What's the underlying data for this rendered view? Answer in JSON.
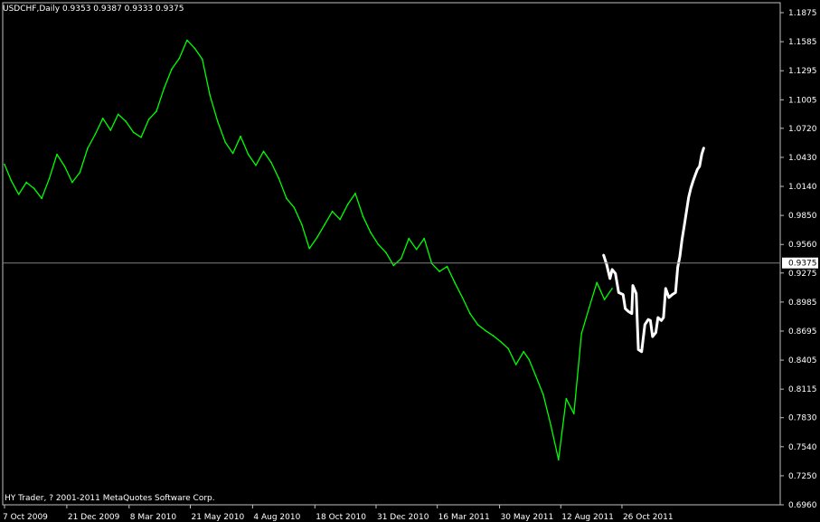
{
  "header": {
    "symbol_line": "USDCHF,Daily  0.9353 0.9387 0.9333 0.9375"
  },
  "footer": {
    "copyright": "HY Trader, ? 2001-2011 MetaQuotes Software Corp."
  },
  "colors": {
    "background": "#000000",
    "frame": "#c0c0c0",
    "history_line": "#00ff00",
    "forecast_line": "#ffffff",
    "current_price_line": "#808080"
  },
  "chart_data": {
    "type": "line",
    "title": "USDCHF,Daily",
    "ohlc_last": {
      "open": 0.9353,
      "high": 0.9387,
      "low": 0.9333,
      "close": 0.9375
    },
    "current_price_label": "0.9375",
    "current_price": 0.9375,
    "ylim": [
      0.6969,
      1.1875
    ],
    "y_ticks": [
      "1.1875",
      "1.1585",
      "1.1295",
      "1.1005",
      "1.0720",
      "1.0430",
      "1.0140",
      "0.9850",
      "0.9560",
      "0.9275",
      "0.8985",
      "0.8695",
      "0.8405",
      "0.8115",
      "0.7830",
      "0.7540",
      "0.7250",
      "0.6960"
    ],
    "x_ticks": [
      "7 Oct 2009",
      "21 Dec 2009",
      "8 Mar 2010",
      "21 May 2010",
      "4 Aug 2010",
      "18 Oct 2010",
      "31 Dec 2010",
      "16 Mar 2011",
      "30 May 2011",
      "12 Aug 2011",
      "26 Oct 2011"
    ],
    "x_index_range": [
      0,
      570
    ],
    "x_tick_indices": [
      0,
      57,
      114,
      170,
      227,
      284,
      340,
      396,
      453,
      509,
      565
    ],
    "series": [
      {
        "color": "#00ff00",
        "x": [
          0,
          6,
          13,
          20,
          27,
          34,
          41,
          48,
          55,
          62,
          69,
          76,
          83,
          90,
          97,
          104,
          111,
          118,
          125,
          132,
          139,
          146,
          153,
          160,
          167,
          174,
          181,
          188,
          195,
          202,
          209,
          216,
          223,
          230,
          237,
          244,
          251,
          258,
          265,
          272,
          279,
          286,
          293,
          300,
          307,
          314,
          321,
          328,
          335,
          342,
          349,
          356,
          363,
          370,
          377,
          384,
          391,
          398,
          405,
          412,
          419,
          426,
          433,
          440,
          447,
          454,
          461,
          468,
          475,
          480,
          486,
          493,
          500,
          507,
          514,
          521,
          528,
          535,
          542,
          549,
          556
        ],
        "values": [
          1.036,
          1.02,
          1.006,
          1.018,
          1.012,
          1.002,
          1.022,
          1.046,
          1.034,
          1.018,
          1.028,
          1.052,
          1.066,
          1.082,
          1.07,
          1.086,
          1.079,
          1.068,
          1.063,
          1.081,
          1.089,
          1.112,
          1.131,
          1.142,
          1.16,
          1.152,
          1.141,
          1.105,
          1.079,
          1.058,
          1.047,
          1.064,
          1.046,
          1.035,
          1.049,
          1.038,
          1.022,
          1.002,
          0.993,
          0.976,
          0.952,
          0.963,
          0.976,
          0.989,
          0.981,
          0.996,
          1.007,
          0.984,
          0.968,
          0.956,
          0.948,
          0.935,
          0.942,
          0.962,
          0.951,
          0.962,
          0.937,
          0.929,
          0.934,
          0.918,
          0.903,
          0.887,
          0.876,
          0.87,
          0.865,
          0.859,
          0.852,
          0.836,
          0.849,
          0.841,
          0.825,
          0.806,
          0.775,
          0.741,
          0.802,
          0.787,
          0.867,
          0.893,
          0.918,
          0.901,
          0.912
        ]
      },
      {
        "color": "#ffffff",
        "x": [
          548,
          551,
          554,
          556,
          559,
          562,
          566,
          568,
          571,
          574,
          575,
          578,
          580,
          583,
          586,
          589,
          591,
          593,
          596,
          598,
          601,
          603,
          605,
          608,
          611,
          614,
          616,
          618,
          620,
          622,
          624,
          626,
          628,
          630,
          632,
          634,
          636,
          638,
          640
        ],
        "values": [
          0.946,
          0.936,
          0.922,
          0.931,
          0.927,
          0.908,
          0.906,
          0.892,
          0.889,
          0.887,
          0.915,
          0.907,
          0.851,
          0.849,
          0.876,
          0.881,
          0.88,
          0.864,
          0.868,
          0.883,
          0.88,
          0.883,
          0.912,
          0.903,
          0.906,
          0.908,
          0.933,
          0.944,
          0.961,
          0.975,
          0.989,
          1.003,
          1.012,
          1.019,
          1.025,
          1.031,
          1.034,
          1.046,
          1.053
        ]
      }
    ]
  }
}
